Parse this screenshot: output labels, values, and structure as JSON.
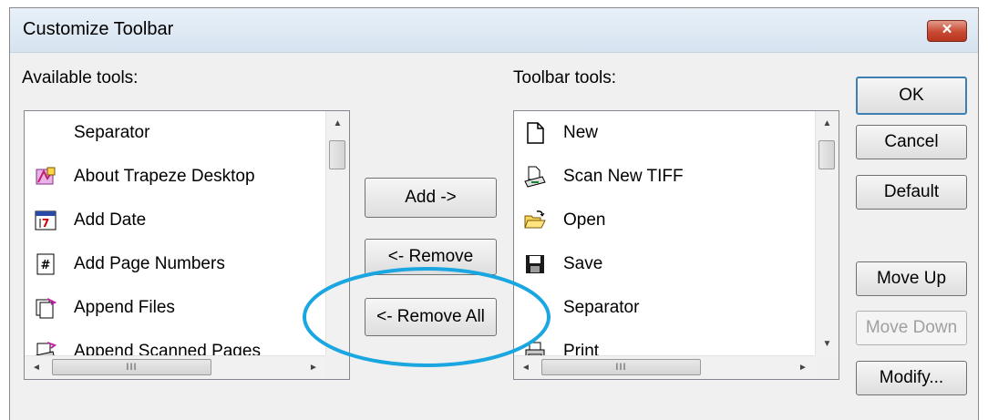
{
  "window": {
    "title": "Customize Toolbar",
    "close_label": "×"
  },
  "available": {
    "label": "Available tools:",
    "items": [
      {
        "label": "Separator",
        "icon": "none"
      },
      {
        "label": "About Trapeze Desktop",
        "icon": "about-trapeze-icon"
      },
      {
        "label": "Add Date",
        "icon": "add-date-icon"
      },
      {
        "label": "Add Page Numbers",
        "icon": "add-page-numbers-icon"
      },
      {
        "label": "Append Files",
        "icon": "append-files-icon"
      },
      {
        "label": "Append Scanned Pages",
        "icon": "append-scanned-pages-icon"
      }
    ]
  },
  "toolbar": {
    "label": "Toolbar tools:",
    "items": [
      {
        "label": "New",
        "icon": "new-document-icon"
      },
      {
        "label": "Scan New TIFF",
        "icon": "scan-new-tiff-icon"
      },
      {
        "label": "Open",
        "icon": "open-folder-icon"
      },
      {
        "label": "Save",
        "icon": "save-disk-icon"
      },
      {
        "label": "Separator",
        "icon": "none"
      },
      {
        "label": "Print",
        "icon": "print-icon"
      }
    ]
  },
  "scroll": {
    "up": "▲",
    "down": "▼",
    "left": "◄",
    "right": "►",
    "grip": "III"
  },
  "buttons": {
    "add": "Add ->",
    "remove": "<- Remove",
    "remove_all": "<- Remove All",
    "ok": "OK",
    "cancel": "Cancel",
    "default": "Default",
    "move_up": "Move Up",
    "move_down": "Move Down",
    "modify": "Modify..."
  },
  "colors": {
    "highlight": "#1aa6e0",
    "close_red": "#c84a32",
    "focus_border": "#3c7fb1"
  }
}
